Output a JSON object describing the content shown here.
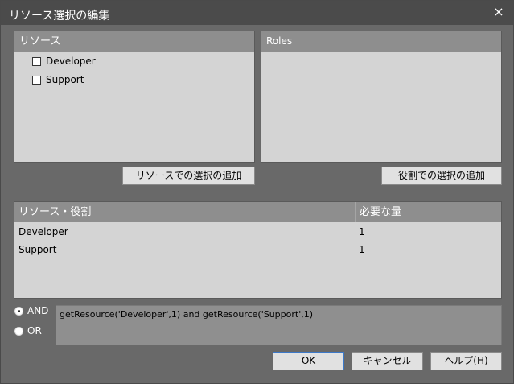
{
  "window": {
    "title": "リソース選択の編集",
    "close_glyph": "×"
  },
  "resources_panel": {
    "header": "リソース",
    "items": [
      {
        "label": "Developer",
        "checked": false
      },
      {
        "label": "Support",
        "checked": false
      }
    ],
    "add_button": "リソースでの選択の追加"
  },
  "roles_panel": {
    "header": "Roles",
    "add_button": "役割での選択の追加"
  },
  "requirements_table": {
    "columns": [
      "リソース・役割",
      "必要な量"
    ],
    "rows": [
      {
        "name": "Developer",
        "amount": "1"
      },
      {
        "name": "Support",
        "amount": "1"
      }
    ]
  },
  "logic": {
    "and_label": "AND",
    "or_label": "OR",
    "selected": "AND",
    "expression": "getResource('Developer',1) and getResource('Support',1)"
  },
  "footer": {
    "ok_label": "OK",
    "cancel_label": "キャンセル",
    "help_label": "ヘルプ(H)"
  },
  "colors": {
    "panel_bg": "#d4d4d4",
    "header_bg": "#8e8e8e",
    "dialog_bg": "#696969",
    "titlebar_bg": "#4b4b4b",
    "default_button_border": "#3b78c8"
  }
}
